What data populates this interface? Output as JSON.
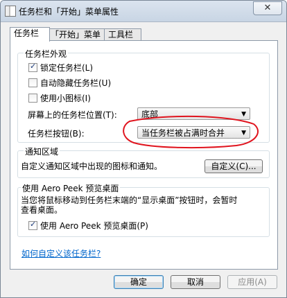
{
  "window": {
    "title": "任务栏和「开始」菜单属性",
    "close_label": "✕"
  },
  "tabs": [
    {
      "label": "任务栏"
    },
    {
      "label": "「开始」菜单"
    },
    {
      "label": "工具栏"
    }
  ],
  "appearance": {
    "label": "任务栏外观",
    "lock_taskbar": {
      "label": "锁定任务栏(L)",
      "checked": true
    },
    "auto_hide": {
      "label": "自动隐藏任务栏(U)",
      "checked": false
    },
    "small_icons": {
      "label": "使用小图标(I)",
      "checked": false
    },
    "position_label": "屏幕上的任务栏位置(T):",
    "position_value": "底部",
    "buttons_label": "任务栏按钮(B):",
    "buttons_value": "当任务栏被占满时合并"
  },
  "notification": {
    "label": "通知区域",
    "desc": "自定义通知区域中出现的图标和通知。",
    "customize_button": "自定义(C)..."
  },
  "aero_peek": {
    "label": "使用 Aero Peek 预览桌面",
    "desc_line1": "当您将鼠标移动到任务栏末端的“显示桌面”按钮时，会暂时",
    "desc_line2": "查看桌面。",
    "checkbox": {
      "label": "使用 Aero Peek 预览桌面(P)",
      "checked": true
    }
  },
  "help_link": "如何自定义该任务栏?",
  "footer": {
    "ok": "确定",
    "cancel": "取消",
    "apply": "应用(A)"
  },
  "check_glyph": "✓",
  "arrow_glyph": "▼"
}
